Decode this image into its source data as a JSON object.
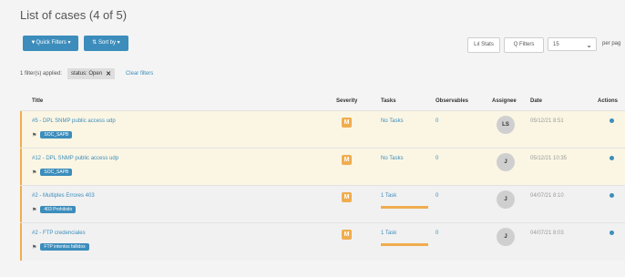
{
  "page": {
    "title": "List of cases (4 of 5)"
  },
  "toolbar": {
    "quick_filters_label": "▼Quick Filters ▾",
    "sort_by_label": "⇅ Sort by ▾",
    "stats_label": "Lıl Stats",
    "filters_label": "Q Filters",
    "per_page_value": "15",
    "per_page_label": "per pag"
  },
  "filters": {
    "applied_text": "1 filter(s) applied:",
    "chip_label": "status: Open",
    "clear_label": "Clear filters"
  },
  "columns": {
    "title": "Title",
    "severity": "Severity",
    "tasks": "Tasks",
    "observables": "Observables",
    "assignee": "Assignee",
    "date": "Date",
    "actions": "Actions"
  },
  "rows": [
    {
      "title": "#5 - DPL SNMP public access udp",
      "tag": "SOC_SAPB",
      "severity": "M",
      "tasks": "No Tasks",
      "observables": "0",
      "assignee": "LS",
      "date": "05/12/21 8:51",
      "task_progress": 0
    },
    {
      "title": "#12 - DPL SNMP public access udp",
      "tag": "SOC_SAPB",
      "severity": "M",
      "tasks": "No Tasks",
      "observables": "0",
      "assignee": "J",
      "date": "05/12/21 10:35",
      "task_progress": 0
    },
    {
      "title": "#2 - Multiples Errores 403",
      "tag": "403 Prohibido",
      "severity": "M",
      "tasks": "1 Task",
      "observables": "0",
      "assignee": "J",
      "date": "04/07/21 8:10",
      "task_progress": 1
    },
    {
      "title": "#2 - FTP credenciales",
      "tag": "FTP intentos fallidos",
      "severity": "M",
      "tasks": "1 Task",
      "observables": "0",
      "assignee": "J",
      "date": "04/07/21 8:03",
      "task_progress": 1
    }
  ],
  "colors": {
    "accent": "#3c8dbc",
    "severity_medium": "#f0ad4e",
    "highlight_row": "#fbf6e4"
  }
}
